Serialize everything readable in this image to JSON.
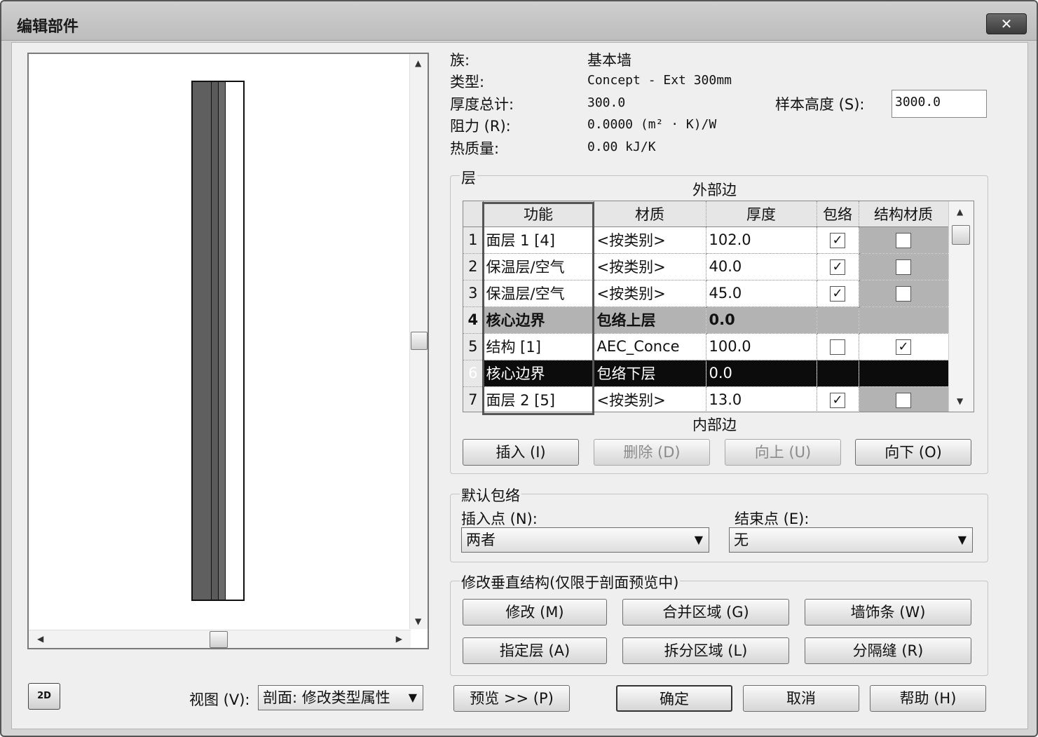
{
  "window": {
    "title": "编辑部件",
    "close_label": "✕"
  },
  "info": {
    "family_label": "族:",
    "family_value": "基本墙",
    "type_label": "类型:",
    "type_value": "Concept - Ext 300mm",
    "thickness_label": "厚度总计:",
    "thickness_value": "300.0",
    "resistance_label": "阻力 (R):",
    "resistance_value": "0.0000 (m² · K)/W",
    "thermal_label": "热质量:",
    "thermal_value": "0.00 kJ/K",
    "sample_height_label": "样本高度 (S):",
    "sample_height_value": "3000.0"
  },
  "layers": {
    "group_title": "层",
    "exterior_label": "外部边",
    "interior_label": "内部边",
    "columns": [
      "功能",
      "材质",
      "厚度",
      "包络",
      "结构材质"
    ],
    "rows": [
      {
        "num": "1",
        "function": "面层 1 [4]",
        "material": "<按类别>",
        "thickness": "102.0",
        "wrap": true,
        "structural": false,
        "style": "normal"
      },
      {
        "num": "2",
        "function": "保温层/空气",
        "material": "<按类别>",
        "thickness": "40.0",
        "wrap": true,
        "structural": false,
        "style": "normal"
      },
      {
        "num": "3",
        "function": "保温层/空气",
        "material": "<按类别>",
        "thickness": "45.0",
        "wrap": true,
        "structural": false,
        "style": "normal"
      },
      {
        "num": "4",
        "function": "核心边界",
        "material": "包络上层",
        "thickness": "0.0",
        "wrap": null,
        "structural": null,
        "style": "core"
      },
      {
        "num": "5",
        "function": "结构 [1]",
        "material": "AEC_Conce",
        "thickness": "100.0",
        "wrap": false,
        "structural": true,
        "style": "normal"
      },
      {
        "num": "6",
        "function": "核心边界",
        "material": "包络下层",
        "thickness": "0.0",
        "wrap": null,
        "structural": null,
        "style": "selected"
      },
      {
        "num": "7",
        "function": "面层 2 [5]",
        "material": "<按类别>",
        "thickness": "13.0",
        "wrap": true,
        "structural": false,
        "style": "normal"
      }
    ],
    "buttons": {
      "insert": "插入 (I)",
      "delete": "删除 (D)",
      "up": "向上 (U)",
      "down": "向下 (O)"
    }
  },
  "default_wrap": {
    "group_title": "默认包络",
    "insert_label": "插入点 (N):",
    "insert_value": "两者",
    "end_label": "结束点 (E):",
    "end_value": "无"
  },
  "vertical": {
    "group_title": "修改垂直结构(仅限于剖面预览中)",
    "modify": "修改 (M)",
    "merge": "合并区域 (G)",
    "sweep": "墙饰条 (W)",
    "assign": "指定层 (A)",
    "split": "拆分区域 (L)",
    "reveal": "分隔缝 (R)"
  },
  "footer": {
    "icon_label": "2D",
    "view_label": "视图 (V):",
    "view_value": "剖面: 修改类型属性",
    "preview": "预览 >> (P)",
    "ok": "确定",
    "cancel": "取消",
    "help": "帮助 (H)"
  }
}
